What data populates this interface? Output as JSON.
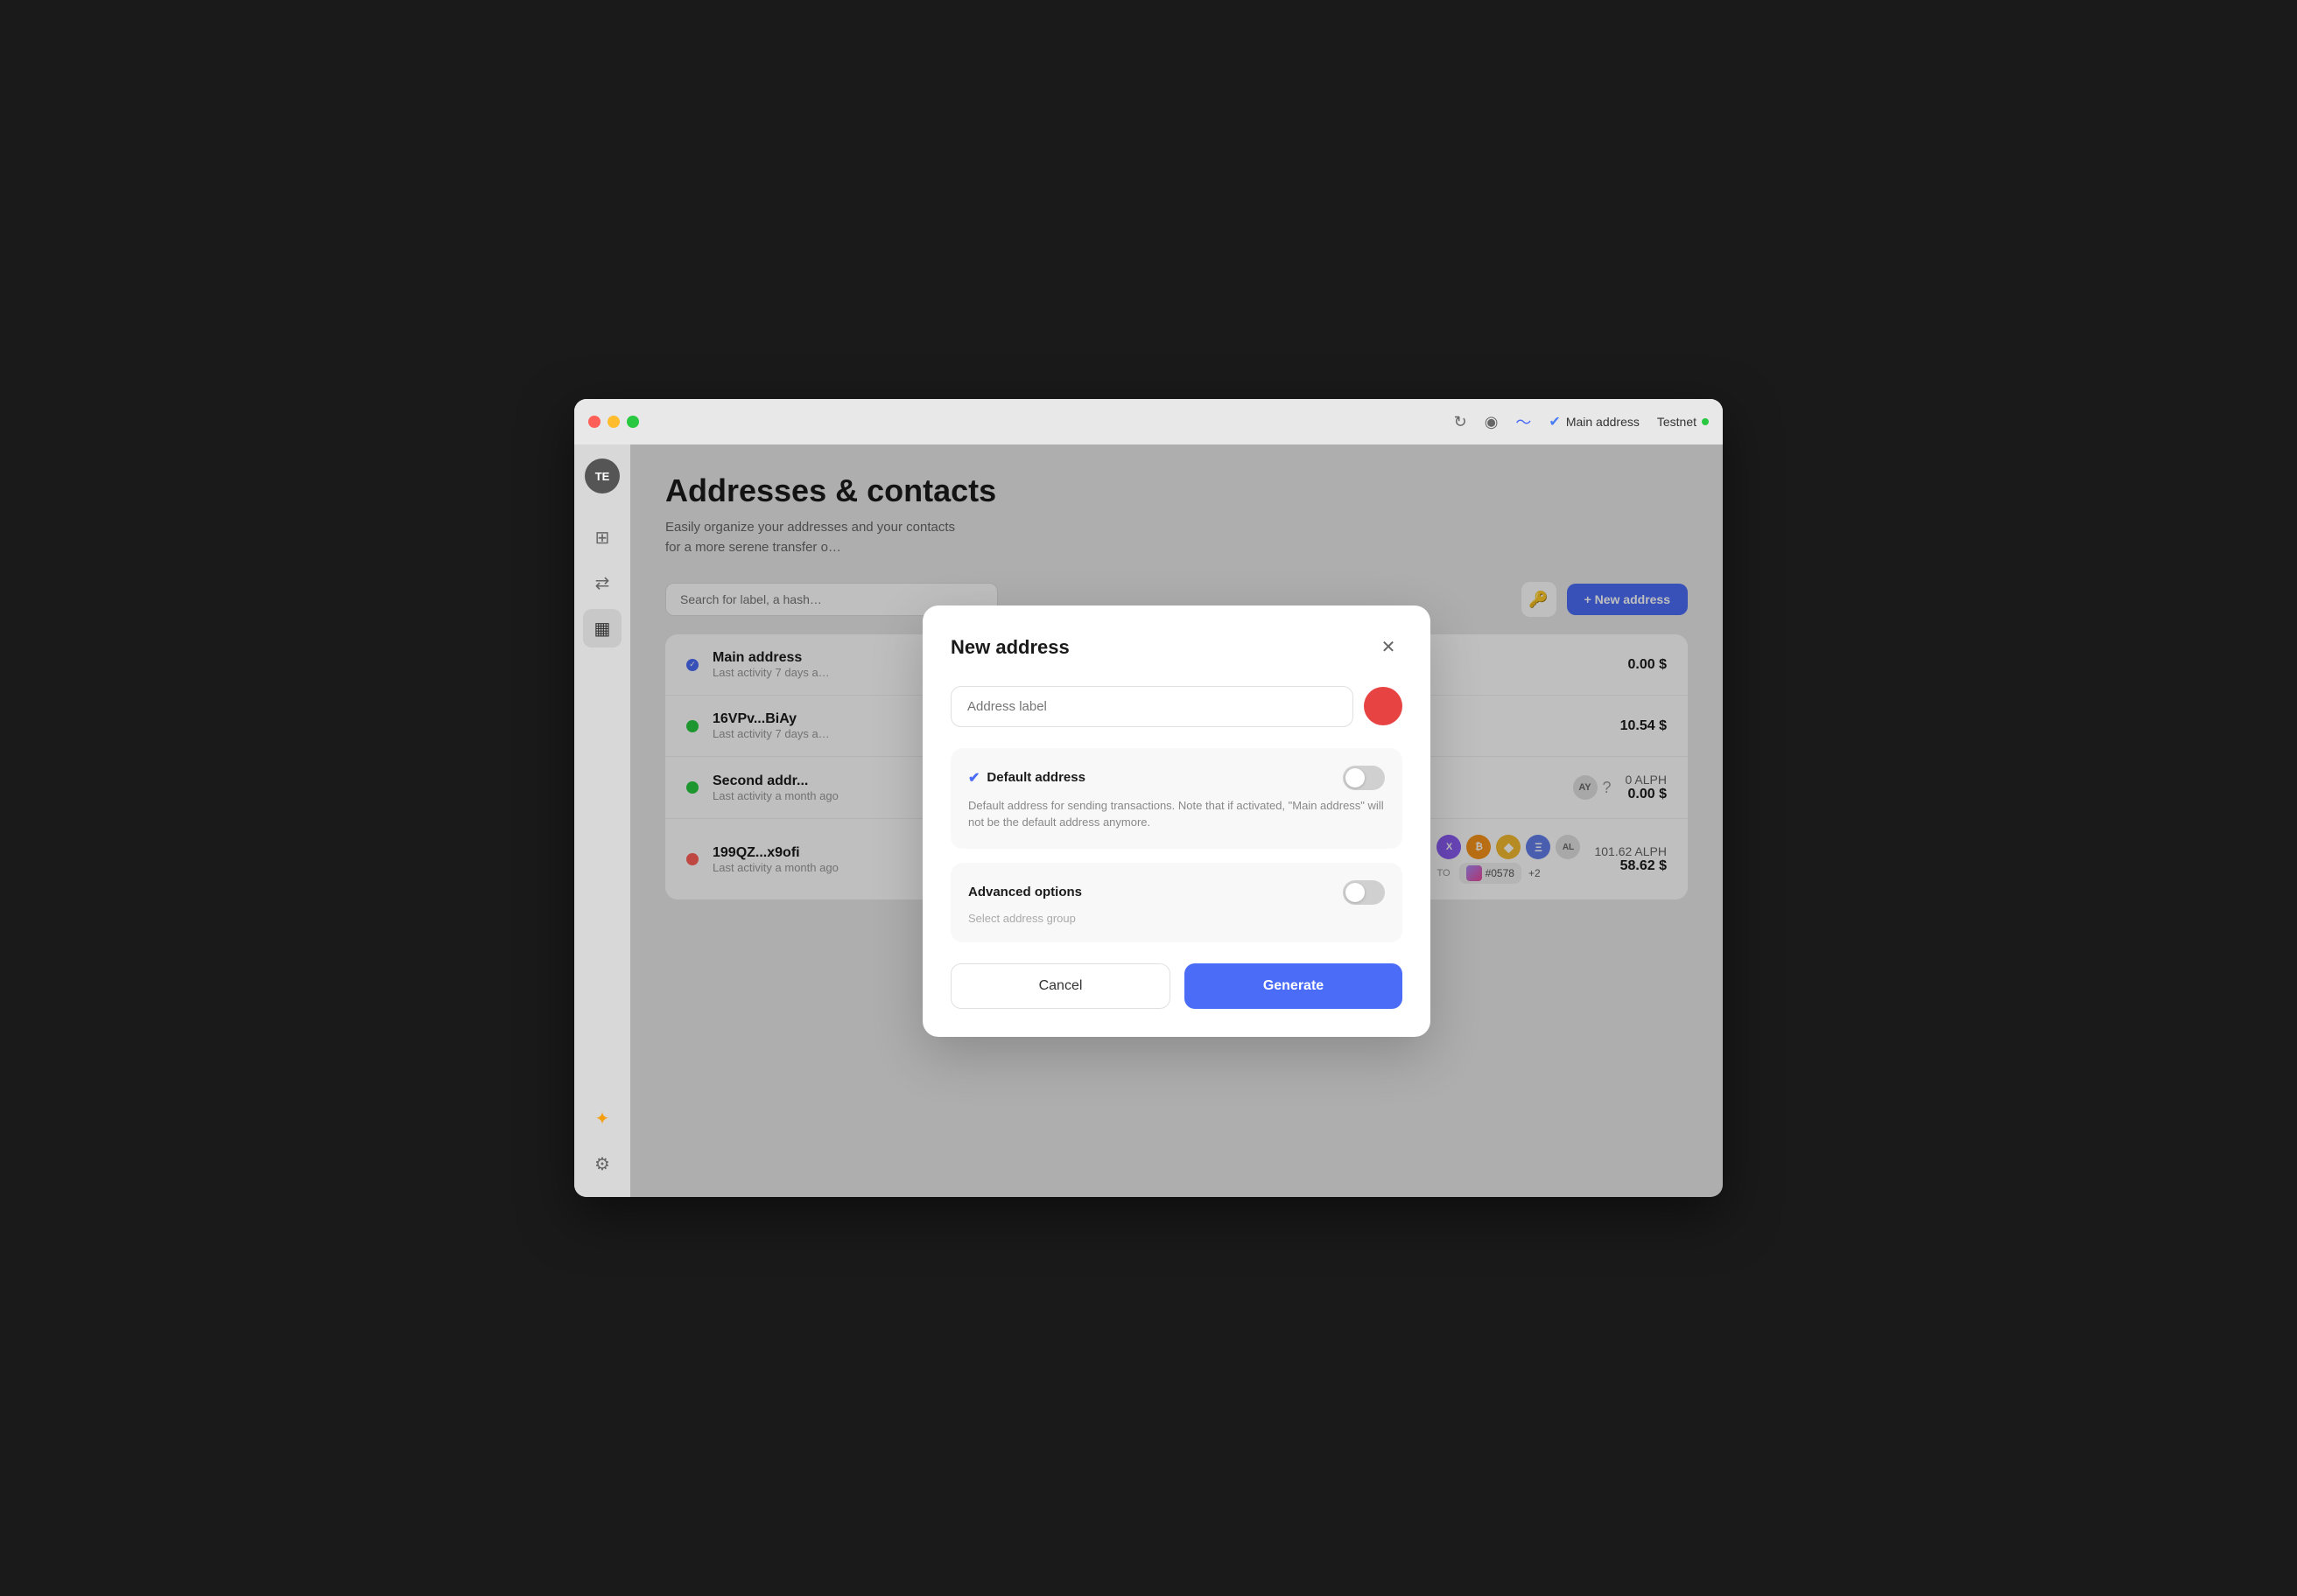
{
  "window": {
    "title": "Addresses & contacts"
  },
  "titlebar": {
    "main_address_label": "Main address",
    "testnet_label": "Testnet"
  },
  "sidebar": {
    "avatar_initials": "TE",
    "items": [
      {
        "id": "layers",
        "icon": "⊞",
        "active": false
      },
      {
        "id": "transfer",
        "icon": "⇄",
        "active": false
      },
      {
        "id": "addresses",
        "icon": "▦",
        "active": true
      },
      {
        "id": "sun",
        "icon": "✦",
        "active": false
      },
      {
        "id": "settings",
        "icon": "⚙",
        "active": false
      }
    ]
  },
  "page": {
    "title": "Addresses & contacts",
    "subtitle": "Easily organize your addresses and your contacts for a more serene transfer o…"
  },
  "toolbar": {
    "search_placeholder": "Search for label, a hash…",
    "new_address_label": "+ New address"
  },
  "addresses": [
    {
      "name": "Main address",
      "activity": "Last activity 7 days a…",
      "indicator": "blue-check",
      "amount_alph": "",
      "amount_usd": "0.00 $"
    },
    {
      "name": "16VPv...BiAy",
      "activity": "Last activity 7 days a…",
      "indicator": "green",
      "amount_alph": "",
      "amount_usd": "10.54 $"
    },
    {
      "name": "Second addr...",
      "activity": "Last activity a month ago",
      "indicator": "green",
      "amount_alph": "0 ALPH",
      "amount_usd": "0.00 $",
      "has_ay_token": true
    },
    {
      "name": "199QZ...x9ofi",
      "activity": "Last activity a month ago",
      "indicator": "red",
      "amount_alph": "101.62 ALPH",
      "amount_usd": "58.62 $",
      "has_tokens": true,
      "nft_id": "#0578",
      "nft_extra": "+2"
    }
  ],
  "modal": {
    "title": "New address",
    "address_label_placeholder": "Address label",
    "default_address_title": "Default address",
    "default_address_desc": "Default address for sending transactions. Note that if activated, \"Main address\" will not be the default address anymore.",
    "advanced_options_title": "Advanced options",
    "advanced_options_sub": "Select address group",
    "cancel_label": "Cancel",
    "generate_label": "Generate",
    "color": "#e84343"
  }
}
